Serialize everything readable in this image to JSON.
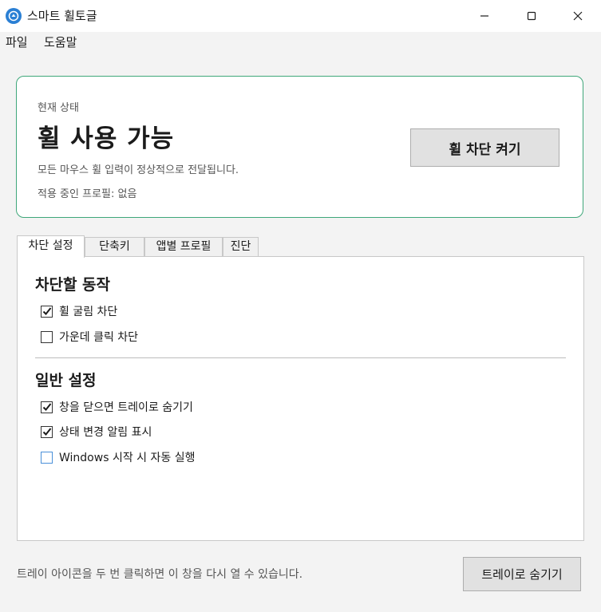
{
  "window": {
    "title": "스마트 휠토글",
    "controls": {
      "minimize": "minimize-icon",
      "maximize": "maximize-icon",
      "close": "close-icon"
    }
  },
  "menu": {
    "file": "파일",
    "help": "도움말"
  },
  "status": {
    "caption": "현재 상태",
    "heading": "휠 사용 가능",
    "description": "모든 마우스 휠 입력이 정상적으로 전달됩니다.",
    "profile": "적용 중인 프로필: 없음",
    "toggle_button": "휠 차단 켜기",
    "accent_color": "#3fa77a"
  },
  "tabs": [
    {
      "label": "차단 설정",
      "active": true
    },
    {
      "label": "단축키",
      "active": false
    },
    {
      "label": "앱별 프로필",
      "active": false
    },
    {
      "label": "진단",
      "active": false
    }
  ],
  "block_settings": {
    "heading": "차단할 동작",
    "options": [
      {
        "label": "휠 굴림 차단",
        "checked": true
      },
      {
        "label": "가운데 클릭 차단",
        "checked": false
      }
    ]
  },
  "general_settings": {
    "heading": "일반 설정",
    "options": [
      {
        "label": "창을 닫으면 트레이로 숨기기",
        "checked": true
      },
      {
        "label": "상태 변경 알림 표시",
        "checked": true
      },
      {
        "label": "Windows 시작 시 자동 실행",
        "checked": false
      }
    ]
  },
  "footer": {
    "hint": "트레이 아이콘을 두 번 클릭하면 이 창을 다시 열 수 있습니다.",
    "tray_button": "트레이로 숨기기"
  }
}
